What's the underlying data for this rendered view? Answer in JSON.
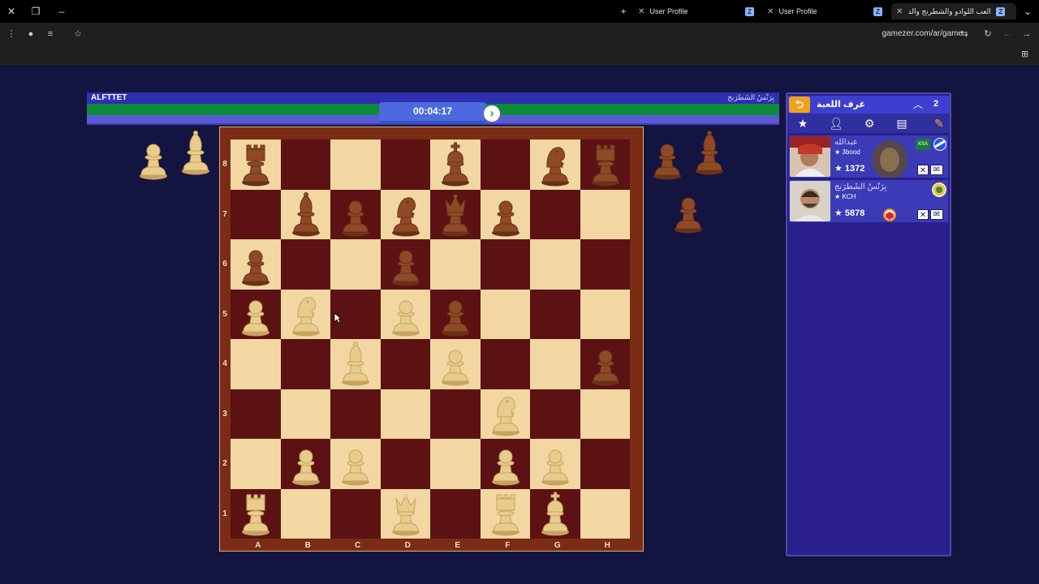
{
  "browser": {
    "tabs": [
      {
        "label": "User Profile",
        "favicon": "Z"
      },
      {
        "label": "User Profile",
        "favicon": "Z"
      },
      {
        "label": "العب اللوادو والشطرنج والد",
        "favicon": "Z"
      }
    ],
    "url": "gamezer.com/ar/game"
  },
  "game": {
    "top_player": "ALFTTET",
    "bottom_player_arabic": "بِرَنْسُ الشَطرَنج",
    "timer": "00:04:17",
    "ranks": [
      "8",
      "7",
      "6",
      "5",
      "4",
      "3",
      "2",
      "1"
    ],
    "files": [
      "A",
      "B",
      "C",
      "D",
      "E",
      "F",
      "G",
      "H"
    ],
    "board": [
      [
        "bR",
        "",
        "",
        "",
        "bK",
        "",
        "bN",
        "bR"
      ],
      [
        "",
        "bB",
        "bP",
        "bN",
        "bQ",
        "bP",
        "",
        ""
      ],
      [
        "bP",
        "",
        "",
        "bP",
        "",
        "",
        "",
        ""
      ],
      [
        "wP",
        "wN",
        "",
        "wP",
        "bP",
        "",
        "",
        ""
      ],
      [
        "",
        "",
        "wB",
        "",
        "wP",
        "",
        "",
        "bP"
      ],
      [
        "",
        "",
        "",
        "",
        "",
        "wN",
        "",
        ""
      ],
      [
        "",
        "wP",
        "wP",
        "",
        "",
        "wP",
        "wP",
        ""
      ],
      [
        "wR",
        "",
        "",
        "wQ",
        "",
        "wR",
        "wK",
        ""
      ]
    ],
    "captured_left": [
      "wP",
      "wB"
    ],
    "captured_right": [
      "bP",
      "bB",
      "bP"
    ]
  },
  "room_panel": {
    "title": "غرف اللعبة",
    "count": "2",
    "players": [
      {
        "name": "عبدالله",
        "sub": "★ 3bood",
        "rating": "★ 1372",
        "country": "KSA"
      },
      {
        "name": "بِرَنْسُ الشَطرَنج",
        "sub": "★ KCH",
        "rating": "★ 5878"
      }
    ]
  },
  "colors": {
    "light_square": "#f2d7a2",
    "dark_square": "#5c1212",
    "white_piece": "#e7cc8c",
    "black_piece": "#8e4a26",
    "panel_bg": "#2a1f8c",
    "accent": "#f2a11c"
  },
  "icons": {
    "back": "arrow-back-icon",
    "tools": [
      "star-icon",
      "user-icon",
      "gear-icon",
      "list-icon",
      "edit-icon"
    ]
  }
}
